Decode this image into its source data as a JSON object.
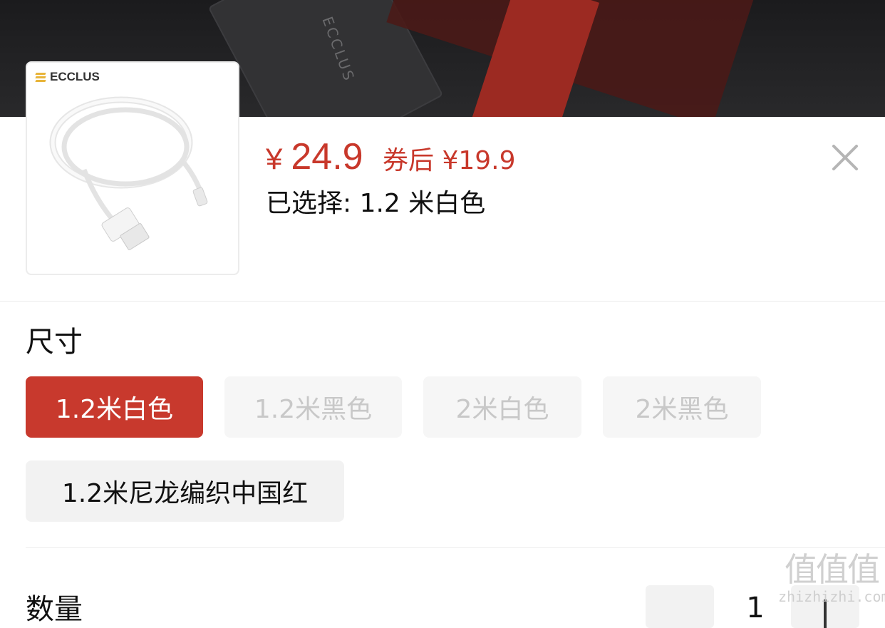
{
  "banner": {
    "brand_text": "ECCLUS"
  },
  "product": {
    "thumb_brand": "ECCLUS",
    "price_symbol": "¥",
    "price": "24.9",
    "coupon_price": "券后 ¥19.9",
    "selected_label": "已选择: 1.2 米白色"
  },
  "spec": {
    "title": "尺寸",
    "options": [
      {
        "label": "1.2米白色",
        "state": "selected"
      },
      {
        "label": "1.2米黑色",
        "state": "disabled"
      },
      {
        "label": "2米白色",
        "state": "disabled"
      },
      {
        "label": "2米黑色",
        "state": "disabled"
      },
      {
        "label": "1.2米尼龙编织中国红",
        "state": "normal"
      }
    ]
  },
  "quantity": {
    "title": "数量",
    "value": "1"
  },
  "watermark": {
    "big": "值值值",
    "small": "zhizhizhi.com"
  },
  "colors": {
    "accent": "#c8382b",
    "disabled_text": "#c8c8c8",
    "option_bg": "#f2f2f2"
  }
}
